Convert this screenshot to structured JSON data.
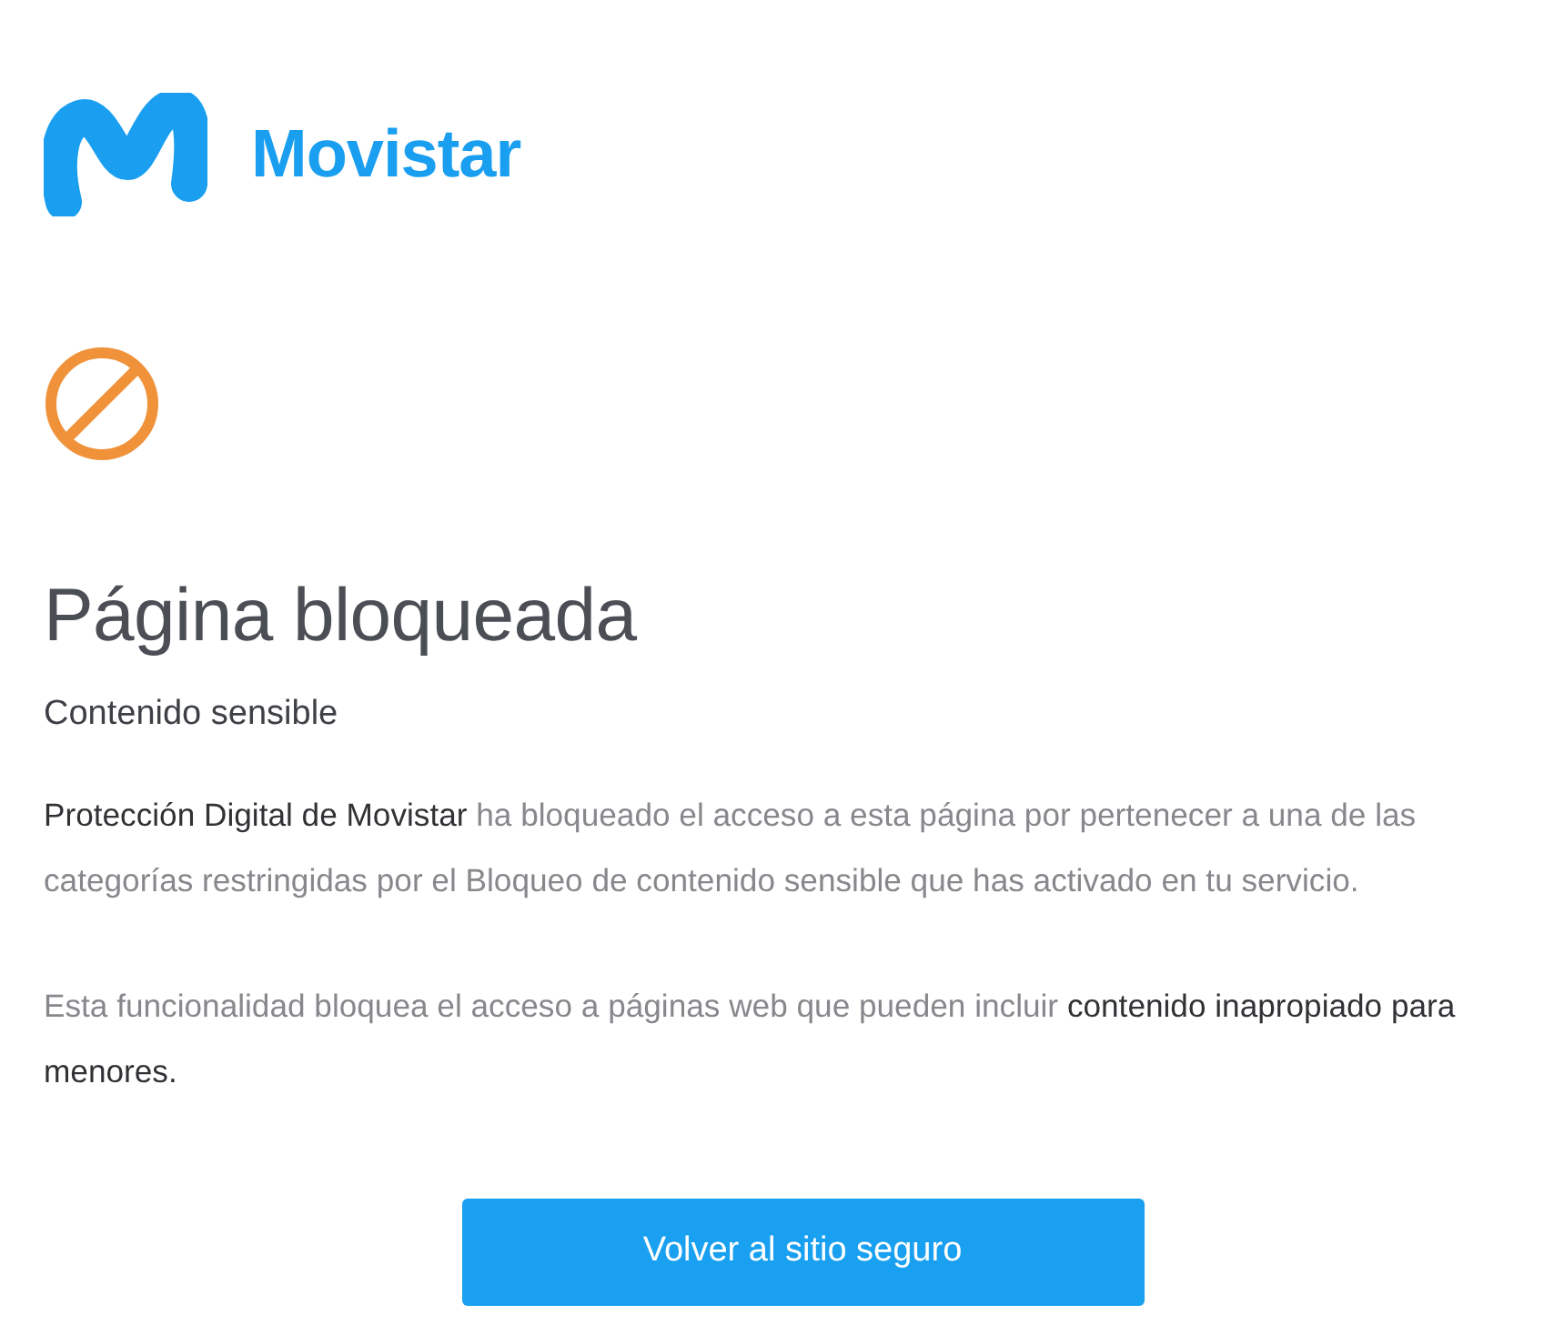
{
  "header": {
    "brand": "Movistar"
  },
  "title": "Página bloqueada",
  "subtitle": "Contenido sensible",
  "paragraphs": [
    {
      "segments": [
        {
          "text": "Protección Digital de Movistar",
          "emphasis": true
        },
        {
          "text": " ha bloqueado el acceso a esta página por pertenecer a una de las categorías restringidas por el Bloqueo de contenido sensible que has activado en tu servicio.",
          "emphasis": false
        }
      ]
    },
    {
      "segments": [
        {
          "text": "Esta funcionalidad bloquea el acceso a páginas web que pueden incluir ",
          "emphasis": false
        },
        {
          "text": "contenido inapropiado para menores.",
          "emphasis": true
        }
      ]
    }
  ],
  "button": {
    "label": "Volver al sitio seguro"
  }
}
